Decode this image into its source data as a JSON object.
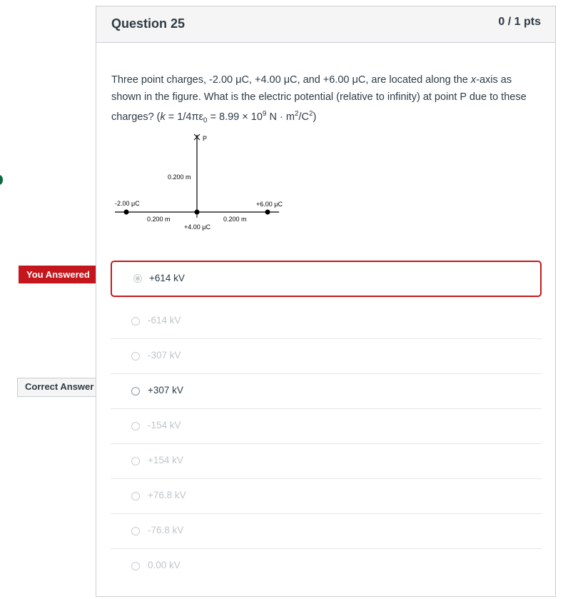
{
  "question": {
    "title": "Question 25",
    "points": "0 / 1 pts",
    "text_line1": "Three point charges, -2.00 μC, +4.00 μC, and +6.00 μC, are located along the ",
    "text_x": "x",
    "text_line1b": "-axis as shown in the figure. What is the electric potential (relative to infinity) at point P due to these charges? (",
    "text_k": "k",
    "text_formula": " = 1/4πε",
    "text_sub0": "0",
    "text_formula2": " = 8.99 × 10",
    "text_sup9": "9",
    "text_formula3": " N · m",
    "text_sup2a": "2",
    "text_formula4": "/C",
    "text_sup2b": "2",
    "text_close": ")"
  },
  "figure": {
    "label_p": "P",
    "label_vertical_dist": "0.200 m",
    "label_charge_left": "-2.00 μC",
    "label_charge_right": "+6.00 μC",
    "label_dist_left": "0.200 m",
    "label_dist_right": "0.200 m",
    "label_charge_center": "+4.00 μC"
  },
  "flags": {
    "you_answered": "You Answered",
    "correct_answer": "Correct Answer"
  },
  "answers": [
    {
      "label": "+614 kV"
    },
    {
      "label": "-614 kV"
    },
    {
      "label": "-307 kV"
    },
    {
      "label": "+307 kV"
    },
    {
      "label": "-154 kV"
    },
    {
      "label": "+154 kV"
    },
    {
      "label": "+76.8 kV"
    },
    {
      "label": "-76.8 kV"
    },
    {
      "label": "0.00 kV"
    }
  ],
  "colors": {
    "wrong_red": "#c4161c",
    "muted_text": "#c0c5c9",
    "body_text": "#2d3b45"
  }
}
